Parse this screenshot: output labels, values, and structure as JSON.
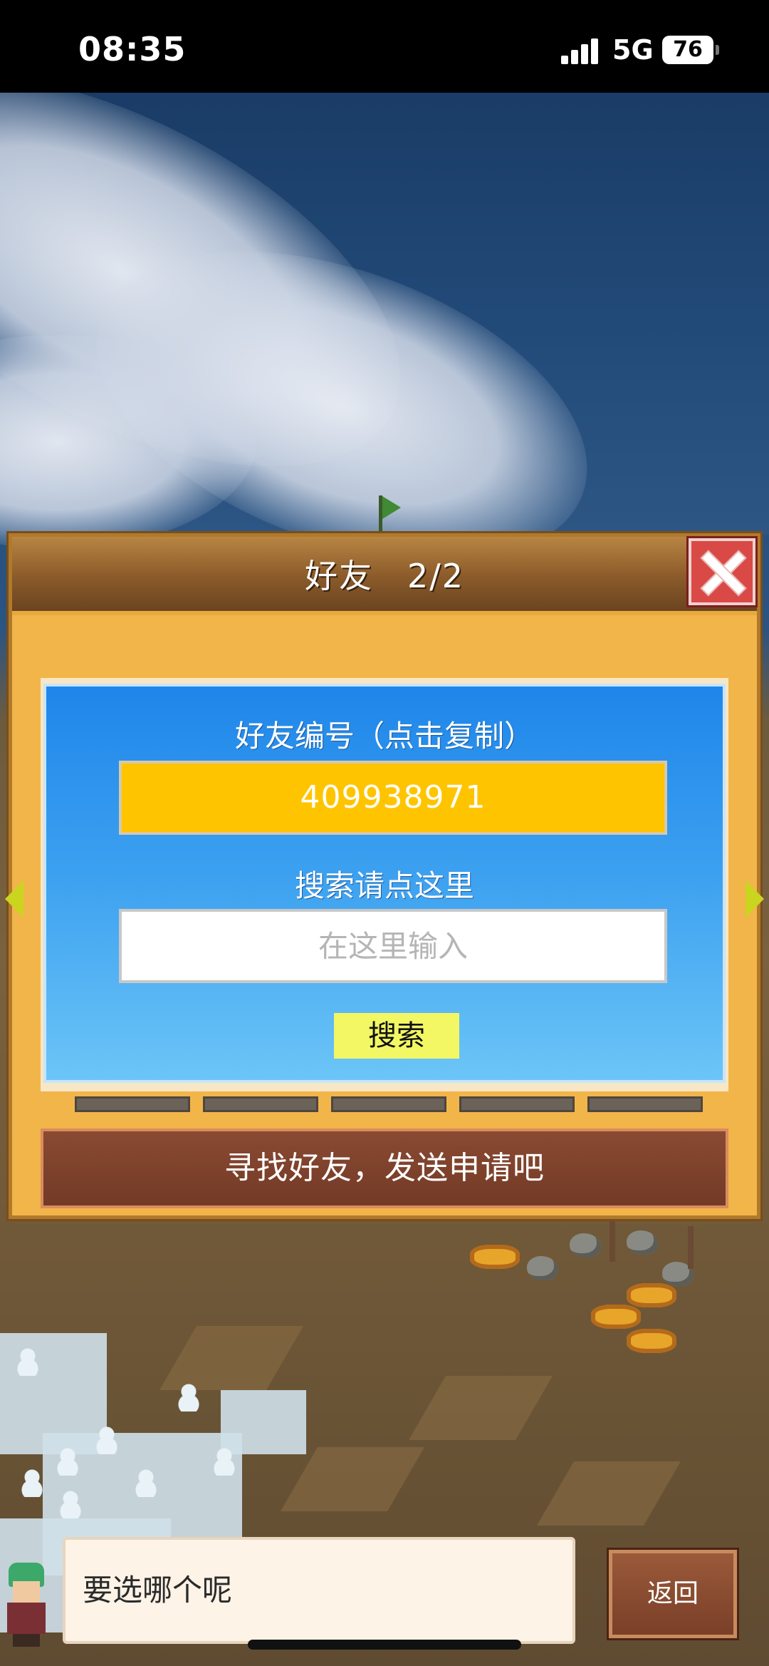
{
  "status_bar": {
    "time": "08:35",
    "network": "5G",
    "battery": "76"
  },
  "dialog": {
    "title": "好友　2/2",
    "close_icon": "close-icon",
    "friend_id_label": "好友编号（点击复制）",
    "friend_id": "409938971",
    "search_label": "搜索请点这里",
    "search_placeholder": "在这里输入",
    "search_button": "搜索",
    "find_friend_prompt": "寻找好友，发送申请吧"
  },
  "bottom": {
    "message": "要选哪个呢",
    "back_button": "返回"
  },
  "colors": {
    "friend_id_bg": "#ffc400",
    "panel_blue": "#1f86ea",
    "close_red": "#d94a46",
    "search_button_bg": "#f2f763"
  }
}
